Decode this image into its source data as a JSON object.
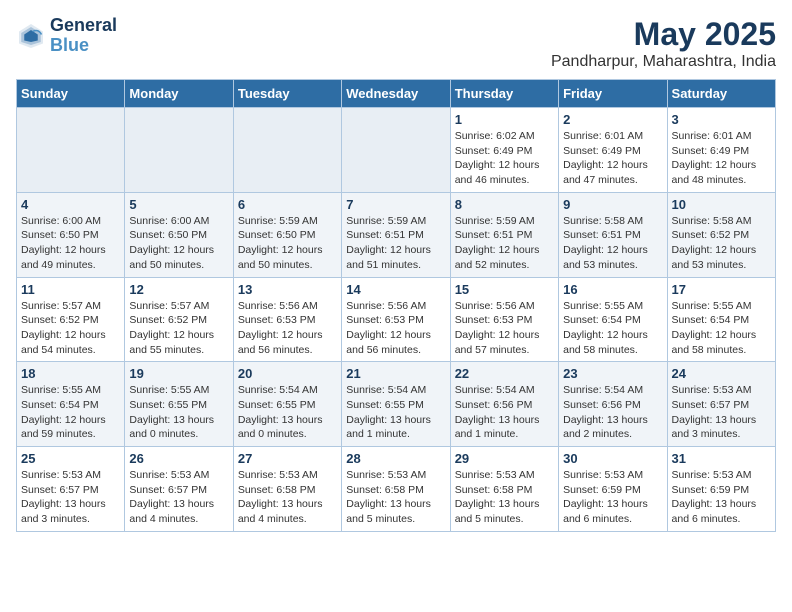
{
  "header": {
    "logo_line1": "General",
    "logo_line2": "Blue",
    "month_title": "May 2025",
    "location": "Pandharpur, Maharashtra, India"
  },
  "weekdays": [
    "Sunday",
    "Monday",
    "Tuesday",
    "Wednesday",
    "Thursday",
    "Friday",
    "Saturday"
  ],
  "weeks": [
    [
      {
        "day": "",
        "info": ""
      },
      {
        "day": "",
        "info": ""
      },
      {
        "day": "",
        "info": ""
      },
      {
        "day": "",
        "info": ""
      },
      {
        "day": "1",
        "info": "Sunrise: 6:02 AM\nSunset: 6:49 PM\nDaylight: 12 hours\nand 46 minutes."
      },
      {
        "day": "2",
        "info": "Sunrise: 6:01 AM\nSunset: 6:49 PM\nDaylight: 12 hours\nand 47 minutes."
      },
      {
        "day": "3",
        "info": "Sunrise: 6:01 AM\nSunset: 6:49 PM\nDaylight: 12 hours\nand 48 minutes."
      }
    ],
    [
      {
        "day": "4",
        "info": "Sunrise: 6:00 AM\nSunset: 6:50 PM\nDaylight: 12 hours\nand 49 minutes."
      },
      {
        "day": "5",
        "info": "Sunrise: 6:00 AM\nSunset: 6:50 PM\nDaylight: 12 hours\nand 50 minutes."
      },
      {
        "day": "6",
        "info": "Sunrise: 5:59 AM\nSunset: 6:50 PM\nDaylight: 12 hours\nand 50 minutes."
      },
      {
        "day": "7",
        "info": "Sunrise: 5:59 AM\nSunset: 6:51 PM\nDaylight: 12 hours\nand 51 minutes."
      },
      {
        "day": "8",
        "info": "Sunrise: 5:59 AM\nSunset: 6:51 PM\nDaylight: 12 hours\nand 52 minutes."
      },
      {
        "day": "9",
        "info": "Sunrise: 5:58 AM\nSunset: 6:51 PM\nDaylight: 12 hours\nand 53 minutes."
      },
      {
        "day": "10",
        "info": "Sunrise: 5:58 AM\nSunset: 6:52 PM\nDaylight: 12 hours\nand 53 minutes."
      }
    ],
    [
      {
        "day": "11",
        "info": "Sunrise: 5:57 AM\nSunset: 6:52 PM\nDaylight: 12 hours\nand 54 minutes."
      },
      {
        "day": "12",
        "info": "Sunrise: 5:57 AM\nSunset: 6:52 PM\nDaylight: 12 hours\nand 55 minutes."
      },
      {
        "day": "13",
        "info": "Sunrise: 5:56 AM\nSunset: 6:53 PM\nDaylight: 12 hours\nand 56 minutes."
      },
      {
        "day": "14",
        "info": "Sunrise: 5:56 AM\nSunset: 6:53 PM\nDaylight: 12 hours\nand 56 minutes."
      },
      {
        "day": "15",
        "info": "Sunrise: 5:56 AM\nSunset: 6:53 PM\nDaylight: 12 hours\nand 57 minutes."
      },
      {
        "day": "16",
        "info": "Sunrise: 5:55 AM\nSunset: 6:54 PM\nDaylight: 12 hours\nand 58 minutes."
      },
      {
        "day": "17",
        "info": "Sunrise: 5:55 AM\nSunset: 6:54 PM\nDaylight: 12 hours\nand 58 minutes."
      }
    ],
    [
      {
        "day": "18",
        "info": "Sunrise: 5:55 AM\nSunset: 6:54 PM\nDaylight: 12 hours\nand 59 minutes."
      },
      {
        "day": "19",
        "info": "Sunrise: 5:55 AM\nSunset: 6:55 PM\nDaylight: 13 hours\nand 0 minutes."
      },
      {
        "day": "20",
        "info": "Sunrise: 5:54 AM\nSunset: 6:55 PM\nDaylight: 13 hours\nand 0 minutes."
      },
      {
        "day": "21",
        "info": "Sunrise: 5:54 AM\nSunset: 6:55 PM\nDaylight: 13 hours\nand 1 minute."
      },
      {
        "day": "22",
        "info": "Sunrise: 5:54 AM\nSunset: 6:56 PM\nDaylight: 13 hours\nand 1 minute."
      },
      {
        "day": "23",
        "info": "Sunrise: 5:54 AM\nSunset: 6:56 PM\nDaylight: 13 hours\nand 2 minutes."
      },
      {
        "day": "24",
        "info": "Sunrise: 5:53 AM\nSunset: 6:57 PM\nDaylight: 13 hours\nand 3 minutes."
      }
    ],
    [
      {
        "day": "25",
        "info": "Sunrise: 5:53 AM\nSunset: 6:57 PM\nDaylight: 13 hours\nand 3 minutes."
      },
      {
        "day": "26",
        "info": "Sunrise: 5:53 AM\nSunset: 6:57 PM\nDaylight: 13 hours\nand 4 minutes."
      },
      {
        "day": "27",
        "info": "Sunrise: 5:53 AM\nSunset: 6:58 PM\nDaylight: 13 hours\nand 4 minutes."
      },
      {
        "day": "28",
        "info": "Sunrise: 5:53 AM\nSunset: 6:58 PM\nDaylight: 13 hours\nand 5 minutes."
      },
      {
        "day": "29",
        "info": "Sunrise: 5:53 AM\nSunset: 6:58 PM\nDaylight: 13 hours\nand 5 minutes."
      },
      {
        "day": "30",
        "info": "Sunrise: 5:53 AM\nSunset: 6:59 PM\nDaylight: 13 hours\nand 6 minutes."
      },
      {
        "day": "31",
        "info": "Sunrise: 5:53 AM\nSunset: 6:59 PM\nDaylight: 13 hours\nand 6 minutes."
      }
    ]
  ]
}
